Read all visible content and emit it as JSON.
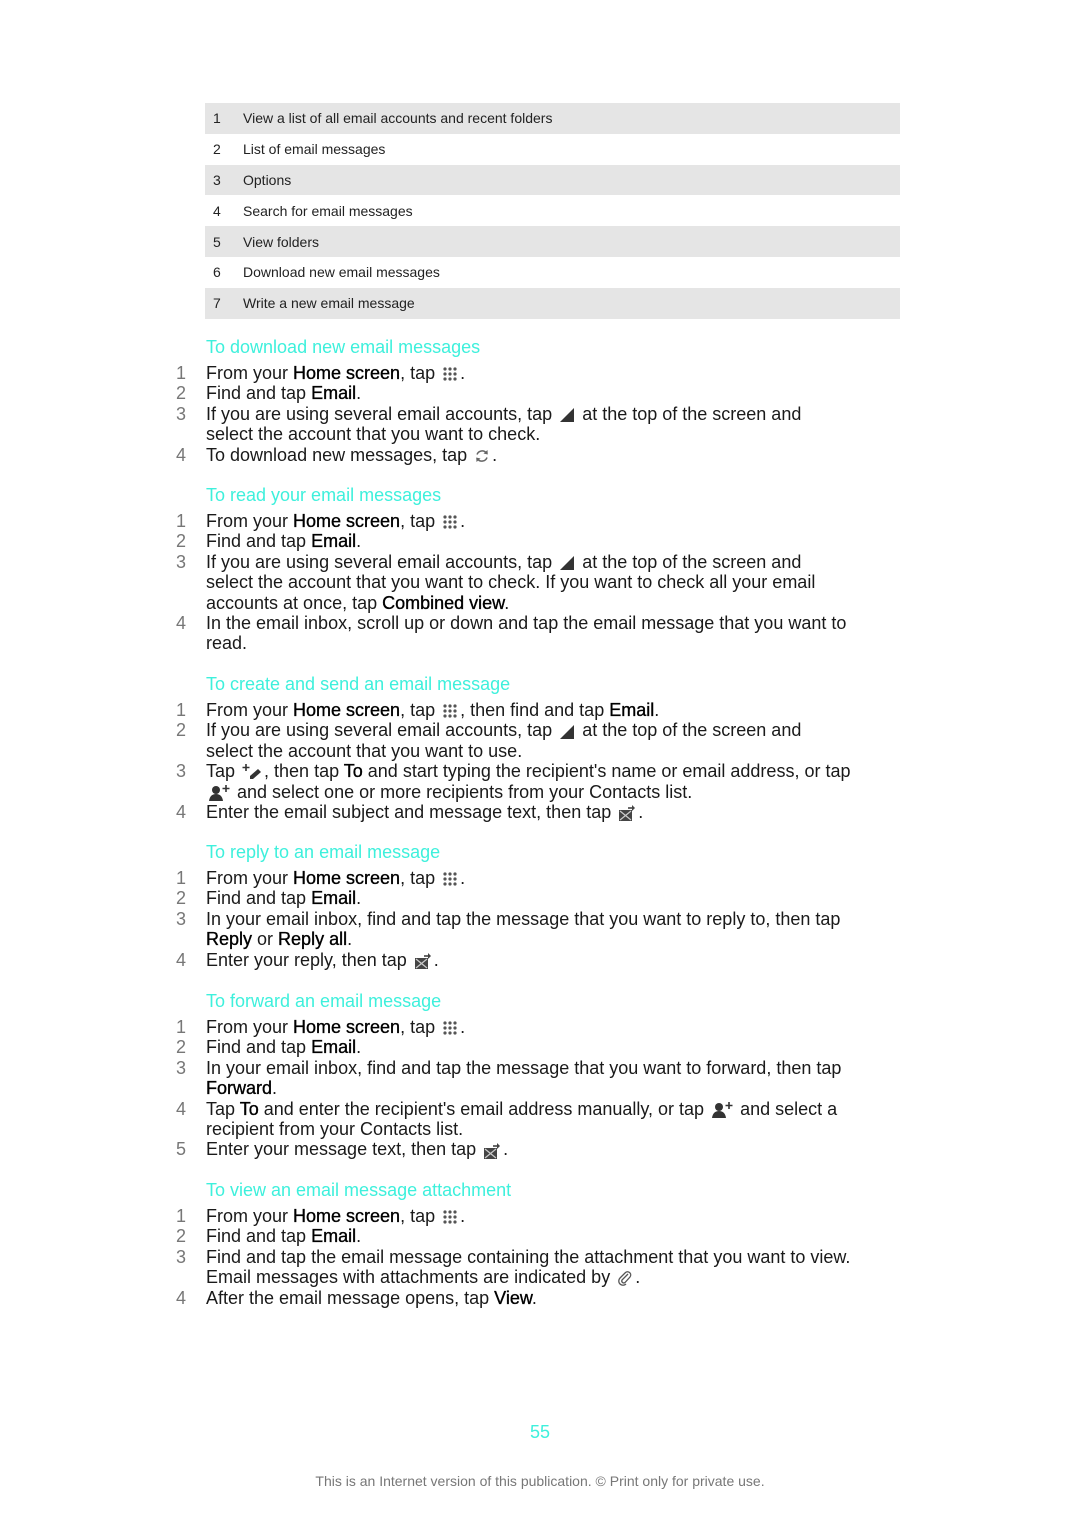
{
  "legend": [
    {
      "num": "1",
      "text": "View a list of all email accounts and recent folders"
    },
    {
      "num": "2",
      "text": "List of email messages"
    },
    {
      "num": "3",
      "text": "Options"
    },
    {
      "num": "4",
      "text": "Search for email messages"
    },
    {
      "num": "5",
      "text": "View folders"
    },
    {
      "num": "6",
      "text": "Download new email messages"
    },
    {
      "num": "7",
      "text": "Write a new email message"
    }
  ],
  "colors": {
    "heading": "#3ef0dc",
    "table_shade": "#e5e5e5",
    "step_number": "#777777"
  },
  "sections": [
    {
      "title": "To download new email messages",
      "steps": [
        {
          "num": "1",
          "parts": [
            {
              "t": "From your "
            },
            {
              "b": "Home screen"
            },
            {
              "t": ", tap "
            },
            {
              "icon": "apps-grid-icon"
            },
            {
              "t": "."
            }
          ]
        },
        {
          "num": "2",
          "parts": [
            {
              "t": "Find and tap "
            },
            {
              "b": "Email"
            },
            {
              "t": "."
            }
          ]
        },
        {
          "num": "3",
          "parts": [
            {
              "t": "If you are using several email accounts, tap "
            },
            {
              "icon": "dropdown-triangle-icon"
            },
            {
              "t": " at the top of the screen and select the account that you want to check."
            }
          ]
        },
        {
          "num": "4",
          "parts": [
            {
              "t": "To download new messages, tap "
            },
            {
              "icon": "refresh-icon"
            },
            {
              "t": "."
            }
          ]
        }
      ]
    },
    {
      "title": "To read your email messages",
      "steps": [
        {
          "num": "1",
          "parts": [
            {
              "t": "From your "
            },
            {
              "b": "Home screen"
            },
            {
              "t": ", tap "
            },
            {
              "icon": "apps-grid-icon"
            },
            {
              "t": "."
            }
          ]
        },
        {
          "num": "2",
          "parts": [
            {
              "t": "Find and tap "
            },
            {
              "b": "Email"
            },
            {
              "t": "."
            }
          ]
        },
        {
          "num": "3",
          "parts": [
            {
              "t": "If you are using several email accounts, tap "
            },
            {
              "icon": "dropdown-triangle-icon"
            },
            {
              "t": " at the top of the screen and select the account that you want to check. If you want to check all your email accounts at once, tap "
            },
            {
              "b": "Combined view"
            },
            {
              "t": "."
            }
          ]
        },
        {
          "num": "4",
          "parts": [
            {
              "t": "In the email inbox, scroll up or down and tap the email message that you want to read."
            }
          ]
        }
      ]
    },
    {
      "title": "To create and send an email message",
      "steps": [
        {
          "num": "1",
          "parts": [
            {
              "t": "From your "
            },
            {
              "b": "Home screen"
            },
            {
              "t": ", tap "
            },
            {
              "icon": "apps-grid-icon"
            },
            {
              "t": ", then find and tap "
            },
            {
              "b": "Email"
            },
            {
              "t": "."
            }
          ]
        },
        {
          "num": "2",
          "parts": [
            {
              "t": "If you are using several email accounts, tap "
            },
            {
              "icon": "dropdown-triangle-icon"
            },
            {
              "t": " at the top of the screen and select the account that you want to use."
            }
          ]
        },
        {
          "num": "3",
          "parts": [
            {
              "t": "Tap "
            },
            {
              "icon": "compose-icon"
            },
            {
              "t": ", then tap "
            },
            {
              "b": "To"
            },
            {
              "t": " and start typing the recipient's name or email address, or tap "
            },
            {
              "icon": "add-contact-icon"
            },
            {
              "t": " and select one or more recipients from your Contacts list."
            }
          ]
        },
        {
          "num": "4",
          "parts": [
            {
              "t": "Enter the email subject and message text, then tap "
            },
            {
              "icon": "send-icon"
            },
            {
              "t": "."
            }
          ]
        }
      ]
    },
    {
      "title": "To reply to an email message",
      "steps": [
        {
          "num": "1",
          "parts": [
            {
              "t": "From your "
            },
            {
              "b": "Home screen"
            },
            {
              "t": ", tap "
            },
            {
              "icon": "apps-grid-icon"
            },
            {
              "t": "."
            }
          ]
        },
        {
          "num": "2",
          "parts": [
            {
              "t": "Find and tap "
            },
            {
              "b": "Email"
            },
            {
              "t": "."
            }
          ]
        },
        {
          "num": "3",
          "parts": [
            {
              "t": "In your email inbox, find and tap the message that you want to reply to, then tap "
            },
            {
              "b": "Reply"
            },
            {
              "t": " or "
            },
            {
              "b": "Reply all"
            },
            {
              "t": "."
            }
          ]
        },
        {
          "num": "4",
          "parts": [
            {
              "t": "Enter your reply, then tap "
            },
            {
              "icon": "send-icon"
            },
            {
              "t": "."
            }
          ]
        }
      ]
    },
    {
      "title": "To forward an email message",
      "steps": [
        {
          "num": "1",
          "parts": [
            {
              "t": "From your "
            },
            {
              "b": "Home screen"
            },
            {
              "t": ", tap "
            },
            {
              "icon": "apps-grid-icon"
            },
            {
              "t": "."
            }
          ]
        },
        {
          "num": "2",
          "parts": [
            {
              "t": "Find and tap "
            },
            {
              "b": "Email"
            },
            {
              "t": "."
            }
          ]
        },
        {
          "num": "3",
          "parts": [
            {
              "t": "In your email inbox, find and tap the message that you want to forward, then tap "
            },
            {
              "b": "Forward"
            },
            {
              "t": "."
            }
          ]
        },
        {
          "num": "4",
          "parts": [
            {
              "t": "Tap "
            },
            {
              "b": "To"
            },
            {
              "t": " and enter the recipient's email address manually, or tap "
            },
            {
              "icon": "add-contact-icon"
            },
            {
              "t": " and select a recipient from your Contacts list."
            }
          ]
        },
        {
          "num": "5",
          "parts": [
            {
              "t": "Enter your message text, then tap "
            },
            {
              "icon": "send-icon"
            },
            {
              "t": "."
            }
          ]
        }
      ]
    },
    {
      "title": "To view an email message attachment",
      "steps": [
        {
          "num": "1",
          "parts": [
            {
              "t": "From your "
            },
            {
              "b": "Home screen"
            },
            {
              "t": ", tap "
            },
            {
              "icon": "apps-grid-icon"
            },
            {
              "t": "."
            }
          ]
        },
        {
          "num": "2",
          "parts": [
            {
              "t": "Find and tap "
            },
            {
              "b": "Email"
            },
            {
              "t": "."
            }
          ]
        },
        {
          "num": "3",
          "parts": [
            {
              "t": "Find and tap the email message containing the attachment that you want to view. Email messages with attachments are indicated by "
            },
            {
              "icon": "attachment-icon"
            },
            {
              "t": "."
            }
          ]
        },
        {
          "num": "4",
          "parts": [
            {
              "t": "After the email message opens, tap "
            },
            {
              "b": "View"
            },
            {
              "t": "."
            }
          ]
        }
      ]
    }
  ],
  "page_number": "55",
  "footer": "This is an Internet version of this publication. © Print only for private use."
}
